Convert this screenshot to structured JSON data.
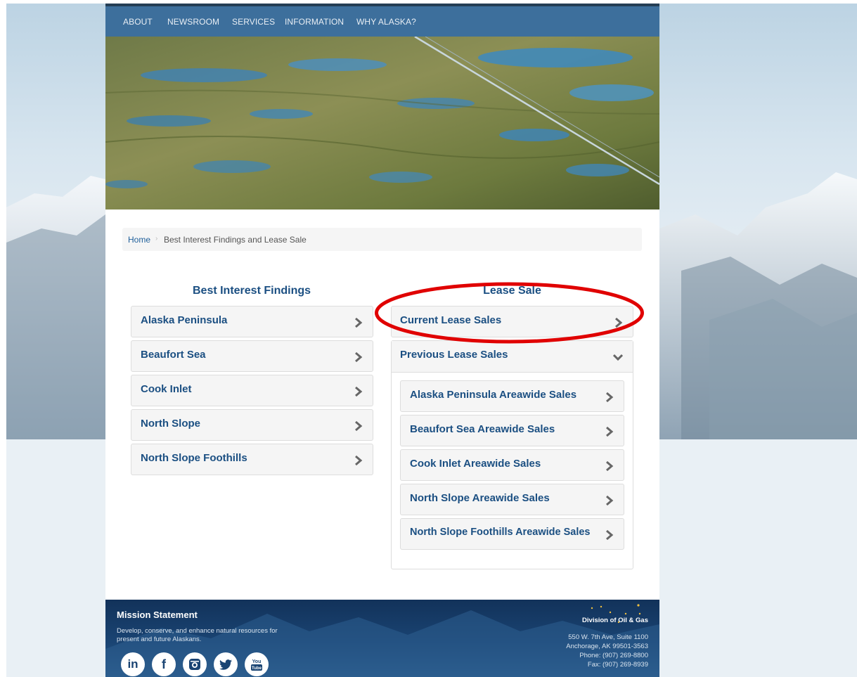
{
  "nav": {
    "items": [
      "ABOUT",
      "NEWSROOM",
      "SERVICES",
      "INFORMATION",
      "WHY ALASKA?"
    ]
  },
  "breadcrumb": {
    "home": "Home",
    "separator": "›",
    "current": "Best Interest Findings and Lease Sale"
  },
  "best_interest": {
    "title": "Best Interest Findings",
    "items": [
      "Alaska Peninsula",
      "Beaufort Sea",
      "Cook Inlet",
      "North Slope",
      "North Slope Foothills"
    ]
  },
  "lease_sale": {
    "title": "Lease Sale",
    "current": "Current Lease Sales",
    "previous": "Previous Lease Sales",
    "previous_items": [
      "Alaska Peninsula Areawide Sales",
      "Beaufort Sea Areawide Sales",
      "Cook Inlet Areawide Sales",
      "North Slope Areawide Sales",
      "North Slope Foothills Areawide Sales"
    ]
  },
  "footer": {
    "mission_title": "Mission Statement",
    "mission_text": "Develop, conserve, and enhance natural resources for present and future Alaskans.",
    "division": "Division of Oil & Gas",
    "address_line1": "550 W. 7th Ave, Suite 1100",
    "address_line2": "Anchorage, AK 99501-3563",
    "phone": "Phone: (907) 269-8800",
    "fax": "Fax: (907) 269-8939",
    "social_icons": [
      "linkedin-icon",
      "facebook-icon",
      "instagram-icon",
      "twitter-icon",
      "youtube-icon"
    ]
  },
  "colors": {
    "nav_bg": "#3d6f9c",
    "link": "#1b4f82",
    "highlight": "#e00000",
    "footer_bg": "#1a4473"
  }
}
